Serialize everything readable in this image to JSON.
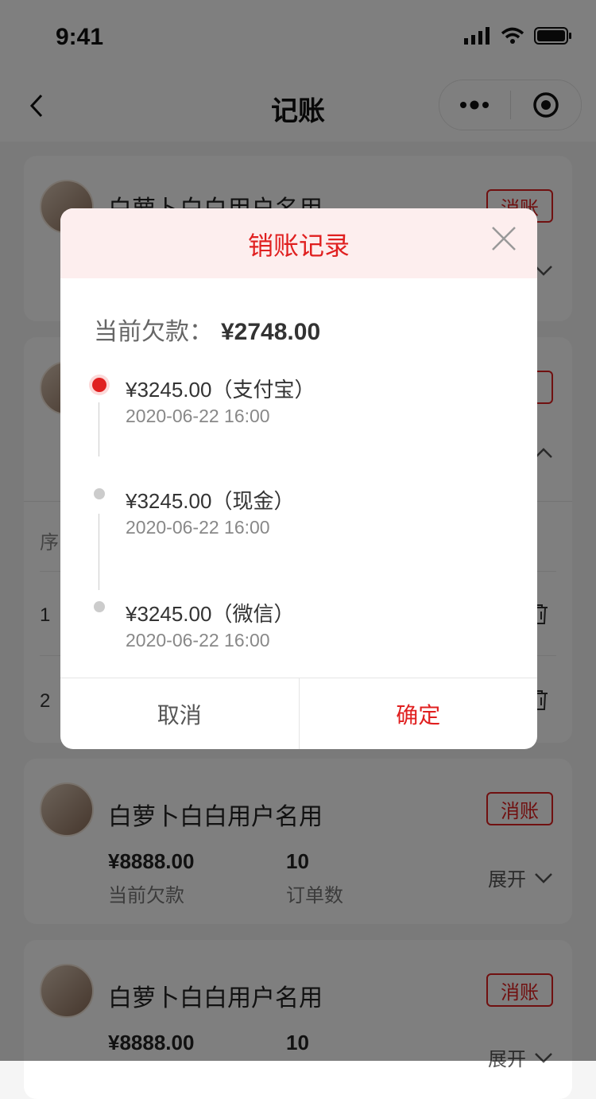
{
  "status": {
    "time": "9:41"
  },
  "nav": {
    "title": "记账",
    "back_icon": "chevron-left-icon",
    "more_icon": "more-dots-icon",
    "target_icon": "target-icon"
  },
  "colors": {
    "accent": "#e02020",
    "modal_header_bg": "#fdeeee",
    "overlay": "rgba(0,0,0,0.5)"
  },
  "cards": [
    {
      "user_name": "白萝卜白白用户名用",
      "action_label": "消账",
      "amount": "",
      "amount_label": "",
      "orders": "",
      "orders_label": "",
      "expand_label": ""
    },
    {
      "user_name": "",
      "action_label": "",
      "table_header": "序",
      "rows": [
        "1",
        "2"
      ]
    },
    {
      "user_name": "白萝卜白白用户名用",
      "action_label": "消账",
      "amount": "¥8888.00",
      "amount_label": "当前欠款",
      "orders": "10",
      "orders_label": "订单数",
      "expand_label": "展开"
    },
    {
      "user_name": "白萝卜白白用户名用",
      "action_label": "消账",
      "amount": "¥8888.00",
      "amount_label": "",
      "orders": "10",
      "orders_label": "",
      "expand_label": "展开"
    }
  ],
  "modal": {
    "title": "销账记录",
    "debt_label": "当前欠款：",
    "debt_amount": "¥2748.00",
    "records": [
      {
        "amount": "¥3245.00（支付宝）",
        "time": "2020-06-22 16:00",
        "active": true
      },
      {
        "amount": "¥3245.00（现金）",
        "time": "2020-06-22 16:00",
        "active": false
      },
      {
        "amount": "¥3245.00（微信）",
        "time": "2020-06-22 16:00",
        "active": false
      }
    ],
    "cancel_label": "取消",
    "confirm_label": "确定"
  }
}
